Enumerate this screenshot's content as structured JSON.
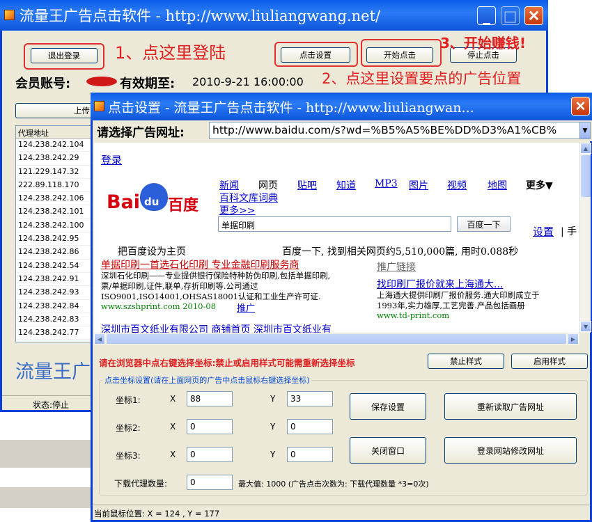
{
  "main_window": {
    "title": "流量王广告点击软件 - http://www.liuliangwang.net/",
    "logout_button": "退出登录",
    "click_settings_button": "点击设置",
    "start_click_button": "开始点击",
    "stop_click_button": "停止点击",
    "annotation_1": "1、点这里登陆",
    "annotation_2": "2、点这里设置要点的广告位置",
    "annotation_3": "3、开始赚钱!",
    "member_account_label": "会员账号:",
    "expiry_label": "有效期至:",
    "expiry_value": "2010-9-21 16:00:00",
    "upload_button": "上传",
    "proxy_header": "代理地址",
    "proxies": [
      "124.238.242.104",
      "124.238.242.29",
      "121.229.147.32",
      "222.89.118.170",
      "124.238.242.106",
      "124.238.242.101",
      "124.238.242.100",
      "124.238.242.95",
      "124.238.242.86",
      "124.238.242.54",
      "124.238.242.91",
      "124.238.242.93",
      "124.238.242.84",
      "124.238.242.83",
      "124.238.242.77"
    ],
    "brand_text": "流量王广",
    "status_text": "状态:停止"
  },
  "settings_window": {
    "title": "点击设置 - 流量王广告点击软件 - http://www.liuliangwan...",
    "url_label": "请选择广告网址:",
    "url_value": "http://www.baidu.com/s?wd=%B5%A5%BE%DD%D3%A1%CB%",
    "instruction": "请在浏览器中点右键选择坐标:禁止或启用样式可能需重新选择坐标",
    "disable_style_button": "禁止样式",
    "enable_style_button": "启用样式",
    "group_title": "点击坐标设置(请在上面网页的广告中点击鼠标右键选择坐标)",
    "coord1_label": "坐标1:",
    "coord2_label": "坐标2:",
    "coord3_label": "坐标3:",
    "x_label": "X",
    "y_label": "Y",
    "coord1_x": "88",
    "coord1_y": "33",
    "coord2_x": "0",
    "coord2_y": "0",
    "coord3_x": "0",
    "coord3_y": "0",
    "save_button": "保存设置",
    "reload_button": "重新读取广告网址",
    "close_button": "关闭窗口",
    "login_site_button": "登录网站修改网址",
    "proxy_count_label": "下载代理数量:",
    "proxy_count_value": "0",
    "max_text": "最大值: 1000 (广告点击次数为: 下载代理数量 *3=0次)",
    "mouse_position": "当前鼠标位置: X = 124 , Y = 177"
  },
  "browser": {
    "login_link": "登录",
    "logo_text_left": "Bai",
    "logo_text_du": "du",
    "logo_text_right": "百度",
    "nav": [
      "新闻",
      "网页",
      "贴吧",
      "知道",
      "MP3",
      "图片",
      "视频",
      "地图"
    ],
    "nav_more": "更多▼",
    "baike_link": "百科文库词典",
    "more_link": "更多>>",
    "search_value": "单据印刷",
    "search_button": "百度一下",
    "settings_link": "设置",
    "settings_sep": "| 手",
    "set_homepage": "把百度设为主页",
    "result_count": "百度一下, 找到相关网页约5,510,000篇, 用时0.088秒",
    "result1_title": "单据印刷一首选石化印刷 专业金融印刷服务商",
    "result1_line1": "深圳石化印刷——专业提供银行保险特种防伪印刷,包括单据印刷,",
    "result1_line2": "票/单据印刷,证件,联单,存折印刷等.公司通过",
    "result1_line3": "ISO9001,ISO14001,OHSAS18001认证和工业生产许可证.",
    "result1_url": "www.szshprint.com 2010-08",
    "result1_promo": "推广",
    "result2_title": "深圳市百文纸业有限公司 商铺首页 深圳市百文纸业有",
    "promo_header": "推广链接",
    "ad_title": "找印刷厂报价就来上海通大...",
    "ad_line1": "上海通大提供印刷厂报价服务.通大印刷成立于",
    "ad_line2": "1993年,实力雄厚,工艺完善.产品包括画册",
    "ad_url": "www.td-print.com"
  },
  "colors": {
    "titlebar": "#0a5ce8",
    "window_bg": "#ece9d8",
    "annotation_red": "#e02020"
  }
}
